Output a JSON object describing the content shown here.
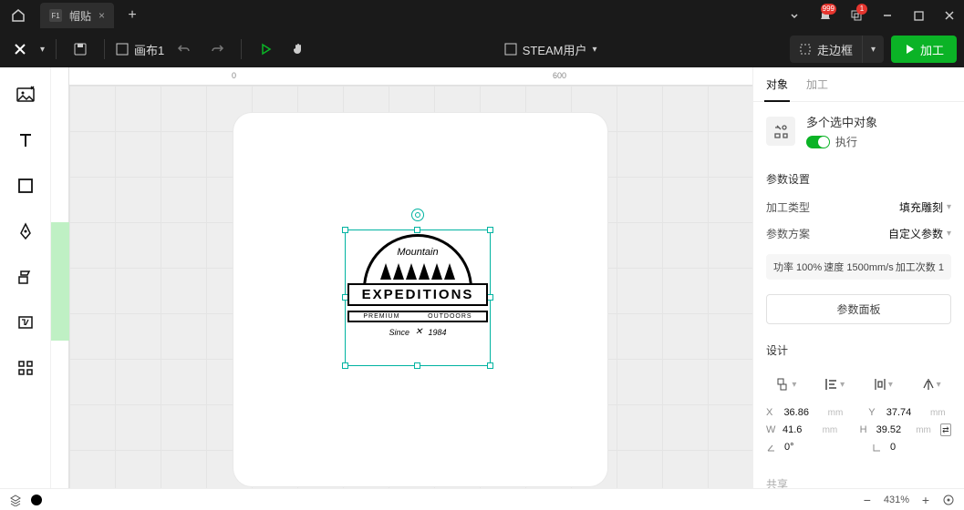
{
  "titlebar": {
    "tab_label": "帽贴",
    "notif_badge": "999",
    "windows_badge": "1"
  },
  "toolbar": {
    "canvas_name": "画布1",
    "user_label": "STEAM用户",
    "walkframe": "走边框",
    "process": "加工"
  },
  "panel": {
    "tabs": {
      "object": "对象",
      "process": "加工"
    },
    "multi_select": "多个选中对象",
    "execute": "执行",
    "params_header": "参数设置",
    "process_type_label": "加工类型",
    "process_type_value": "填充雕刻",
    "scheme_label": "参数方案",
    "scheme_value": "自定义参数",
    "chips": {
      "power": "功率 100%",
      "speed": "速度 1500mm/s",
      "passes": "加工次数 1"
    },
    "param_panel": "参数面板",
    "design_header": "设计",
    "coords": {
      "x": "36.86",
      "y": "37.74",
      "w": "41.6",
      "h": "39.52",
      "r": "0°",
      "c": "0",
      "unit": "mm"
    },
    "share_header": "共享"
  },
  "logo": {
    "mountain": "Mountain",
    "expeditions": "EXPEDITIONS",
    "premium": "PREMIUM",
    "outdoors": "OUTDOORS",
    "since": "Since",
    "year": "1984"
  },
  "ruler": {
    "zero": "0",
    "h600": "600"
  },
  "status": {
    "zoom": "431%"
  }
}
